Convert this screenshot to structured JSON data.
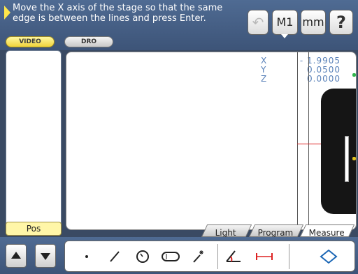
{
  "header": {
    "prompt": "Move the X axis of the stage so that the same edge is between the lines and press Enter.",
    "modes": {
      "video_label": "VIDEO",
      "dro_label": "DRO"
    },
    "tools": {
      "undo_icon": "undo-icon",
      "m1_label": "M1",
      "units_label": "mm",
      "help_label": "?"
    }
  },
  "left_panel": {
    "pos_label": "Pos"
  },
  "readout": {
    "axes": [
      "X",
      "Y",
      "Z"
    ],
    "values": [
      "- 1.9905",
      "0.0500",
      "0.0000"
    ],
    "color": "#5880b8"
  },
  "tabs": {
    "light": "Light",
    "program": "Program",
    "measure": "Measure"
  },
  "features": [
    {
      "name": "point-icon"
    },
    {
      "name": "line-icon"
    },
    {
      "name": "circle-icon"
    },
    {
      "name": "slot-icon"
    },
    {
      "name": "auto-feature-icon"
    },
    {
      "name": "angle-icon"
    },
    {
      "name": "distance-icon"
    },
    {
      "name": "rectangle-icon"
    }
  ]
}
